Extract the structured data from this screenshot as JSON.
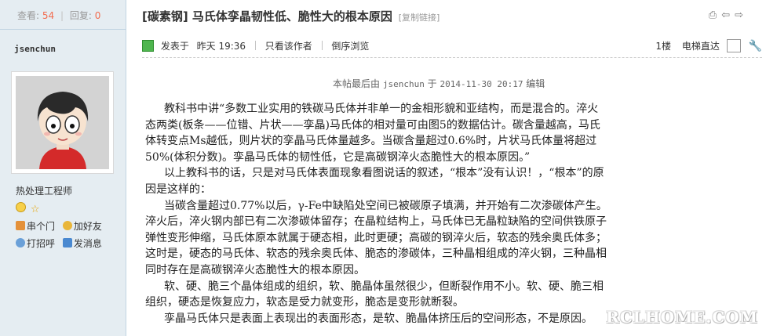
{
  "stats": {
    "views_label": "查看:",
    "views": "54",
    "replies_label": "回复:",
    "replies": "0"
  },
  "author": {
    "name": "jsenchun",
    "group": "热处理工程师",
    "actions": [
      "串个门",
      "加好友",
      "打招呼",
      "发消息"
    ]
  },
  "thread": {
    "title": "[碳素钢] 马氏体孪晶韧性低、脆性大的根本原因",
    "copy_link": "[复制链接]"
  },
  "post_meta": {
    "posted_label": "发表于",
    "posted_time": "昨天 19:36",
    "only_author": "只看该作者",
    "reverse_order": "倒序浏览",
    "floor": "1楼",
    "jump_label": "电梯直达"
  },
  "edit_note": {
    "prefix": "本帖最后由",
    "user": "jsenchun",
    "mid": "于",
    "datetime": "2014-11-30 20:17",
    "suffix": "编辑"
  },
  "content": {
    "paragraphs": [
      "教科书中讲“多数工业实用的铁碳马氏体并非单一的金相形貌和亚结构，而是混合的。淬火态两类(板条——位错、片状——孪晶)马氏体的相对量可由图5的数据估计。碳含量越高，马氏体转变点Ms越低，则片状的孪晶马氏体量越多。当碳含量超过0.6%时，片状马氏体量将超过50%(体积分数)。孪晶马氏体的韧性低，它是高碳钢淬火态脆性大的根本原因。”",
      "以上教科书的话，只是对马氏体表面现象看图说话的叙述，“根本”没有认识！，“根本”的原因是这样的：",
      "当碳含量超过0.77%以后，γ-Fe中缺陷处空间已被碳原子填满，并开始有二次渗碳体产生。淬火后，淬火钢内部已有二次渗碳体留存；在晶粒结构上，马氏体已无晶粒缺陷的空间供铁原子弹性变形伸缩，马氏体原本就属于硬态相，此时更硬；高碳的钢淬火后，软态的残余奥氏体多；这时是，硬态的马氏体、软态的残余奥氏体、脆态的渗碳体，三种晶相组成的淬火钢，三种晶相同时存在是高碳钢淬火态脆性大的根本原因。",
      "软、硬、脆三个晶体组成的组织，软、脆晶体虽然很少，但断裂作用不小。软、硬、脆三相组织，硬态是恢复应力，软态是受力就变形，脆态是变形就断裂。",
      "孪晶马氏体只是表面上表现出的表面形态，是软、脆晶体挤压后的空间形态，不是原因。"
    ]
  },
  "watermark": "RCLHOME.COM"
}
